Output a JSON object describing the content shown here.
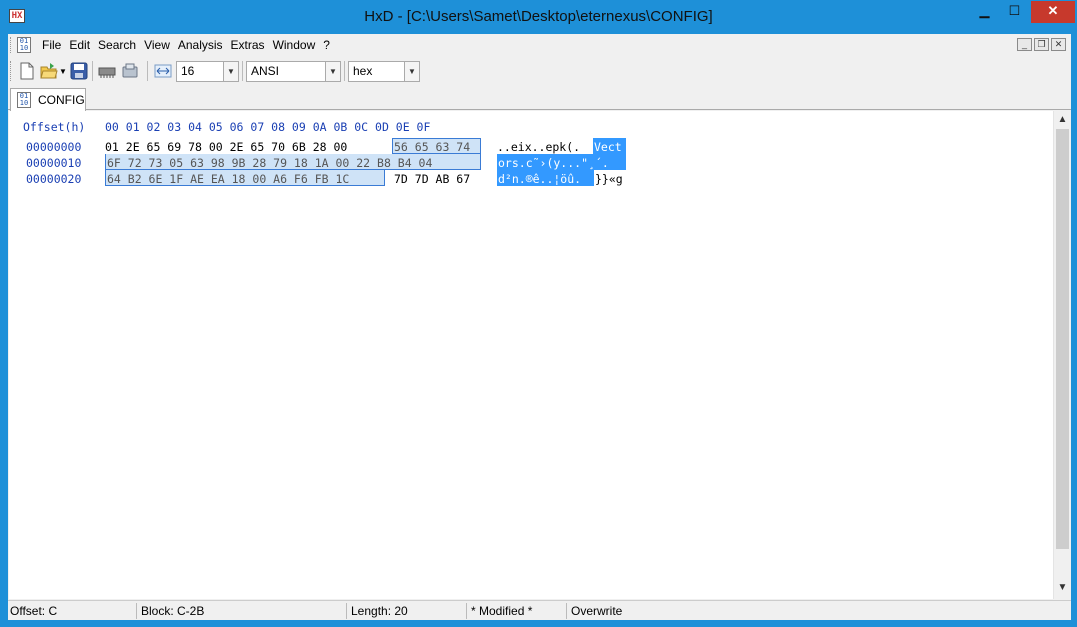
{
  "window": {
    "title": "HxD - [C:\\Users\\Samet\\Desktop\\eternexus\\CONFIG]",
    "min_label": "▁",
    "max_label": "☐",
    "close_label": "✕"
  },
  "menu": [
    "File",
    "Edit",
    "Search",
    "View",
    "Analysis",
    "Extras",
    "Window",
    "?"
  ],
  "toolbar": {
    "bytes_per_row": "16",
    "charset": "ANSI",
    "offset_base": "hex"
  },
  "tab": {
    "label": "CONFIG"
  },
  "editor": {
    "header_offset": "Offset(h)",
    "header_columns": "00 01 02 03 04 05 06 07 08 09 0A 0B 0C 0D 0E 0F",
    "rows": [
      {
        "offset": "00000000",
        "hex_plain": "01 2E 65 69 78 00 2E 65 70 6B 28 00",
        "hex_selected": "56 65 63 74",
        "text_plain": "..eix..epk(.",
        "text_selected": "Vect"
      },
      {
        "offset": "00000010",
        "hex_plain": "",
        "hex_selected": "6F 72 73 05 63 98 9B 28 79 18 1A 00 22 B8 B4 04",
        "text_plain": "",
        "text_selected": "ors.c˜›(y...\"¸´."
      },
      {
        "offset": "00000020",
        "hex_selected": "64 B2 6E 1F AE EA 18 00 A6 F6 FB 1C",
        "hex_plain": "7D 7D AB 67",
        "text_selected": "d²n.®ê..¦öû.",
        "text_plain": "}}«g"
      }
    ]
  },
  "status": {
    "offset": "Offset: C",
    "block": "Block: C-2B",
    "length": "Length: 20",
    "modified": "* Modified *",
    "mode": "Overwrite"
  },
  "icons": {
    "scroll_up": "▲",
    "scroll_down": "▼",
    "combo_arrow": "▼"
  }
}
